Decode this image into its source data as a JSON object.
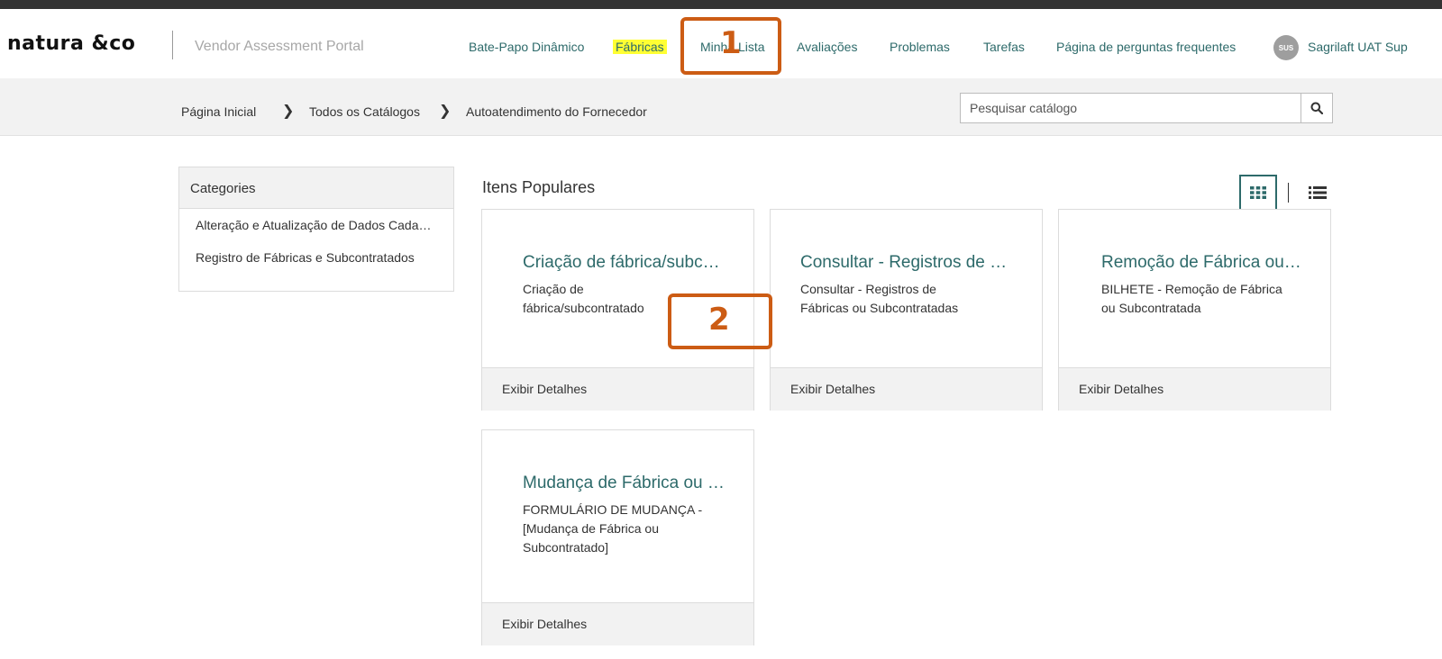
{
  "header": {
    "logo": "natura &co",
    "portal_title": "Vendor Assessment Portal",
    "nav": [
      "Bate-Papo Dinâmico",
      "Fábricas",
      "Minha Lista",
      "Avaliações",
      "Problemas",
      "Tarefas",
      "Página de perguntas frequentes"
    ],
    "user_initials": "SUS",
    "user_name": "Sagrilaft UAT Sup"
  },
  "breadcrumb": {
    "items": [
      "Página Inicial",
      "Todos os Catálogos",
      "Autoatendimento do Fornecedor"
    ],
    "separator": "❯"
  },
  "search": {
    "placeholder": "Pesquisar catálogo"
  },
  "categories": {
    "header": "Categories",
    "items": [
      "Alteração e Atualização de Dados Cadastrais",
      "Registro de Fábricas e Subcontratados"
    ]
  },
  "main": {
    "section_title": "Itens Populares",
    "cards": [
      {
        "title": "Criação de fábrica/subcontratado",
        "desc": "Criação de fábrica/subcontratado",
        "footer": "Exibir Detalhes"
      },
      {
        "title": "Consultar - Registros de Fábricas ou Subcontratadas",
        "desc": "Consultar - Registros de Fábricas ou Subcontratadas",
        "footer": "Exibir Detalhes"
      },
      {
        "title": "Remoção de Fábrica ou Subcontratada",
        "desc": "BILHETE - Remoção de Fábrica ou Subcontratada",
        "footer": "Exibir Detalhes"
      },
      {
        "title": "Mudança de Fábrica ou Subcontratado",
        "desc": "FORMULÁRIO DE MUDANÇA - [Mudança de Fábrica ou Subcontratado]",
        "footer": "Exibir Detalhes"
      }
    ]
  },
  "annotations": [
    "1",
    "2"
  ],
  "colors": {
    "accent": "#2d6a6a",
    "highlight": "#ffff33",
    "annotation": "#cc5c14",
    "topbar": "#333333"
  },
  "icons": {
    "search": "search-icon",
    "grid_view": "grid-view-icon",
    "list_view": "list-view-icon"
  }
}
